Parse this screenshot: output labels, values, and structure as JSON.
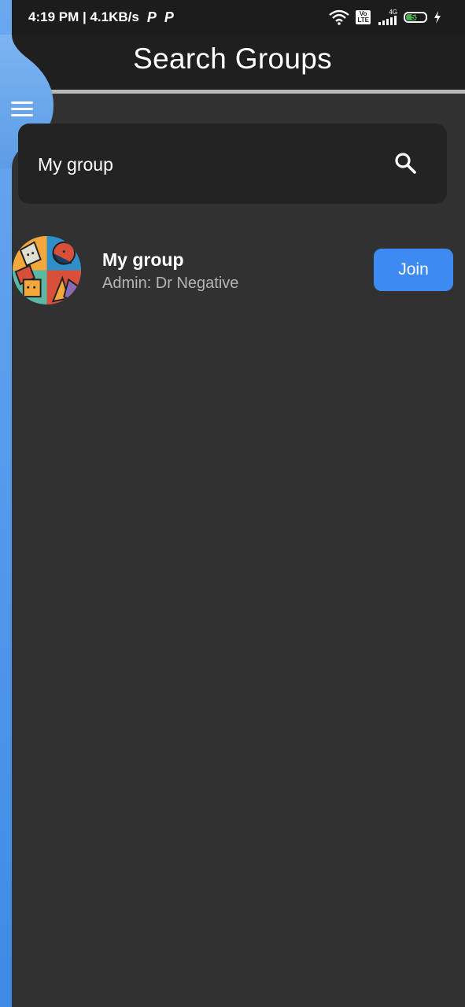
{
  "status_bar": {
    "time_speed": "4:19 PM | 4.1KB/s",
    "notif_icons": [
      "P",
      "P"
    ],
    "volte_label": "Vo\nLTE",
    "network_label": "4G",
    "battery_level": "55"
  },
  "header": {
    "title": "Search Groups"
  },
  "search": {
    "value": "My group",
    "placeholder": ""
  },
  "results": [
    {
      "name": "My group",
      "admin": "Admin: Dr Negative",
      "action_label": "Join"
    }
  ],
  "colors": {
    "accent": "#3d8bf2",
    "background": "#313131",
    "app_bar": "#1f1f1f",
    "drawer": "#5a9de8"
  }
}
